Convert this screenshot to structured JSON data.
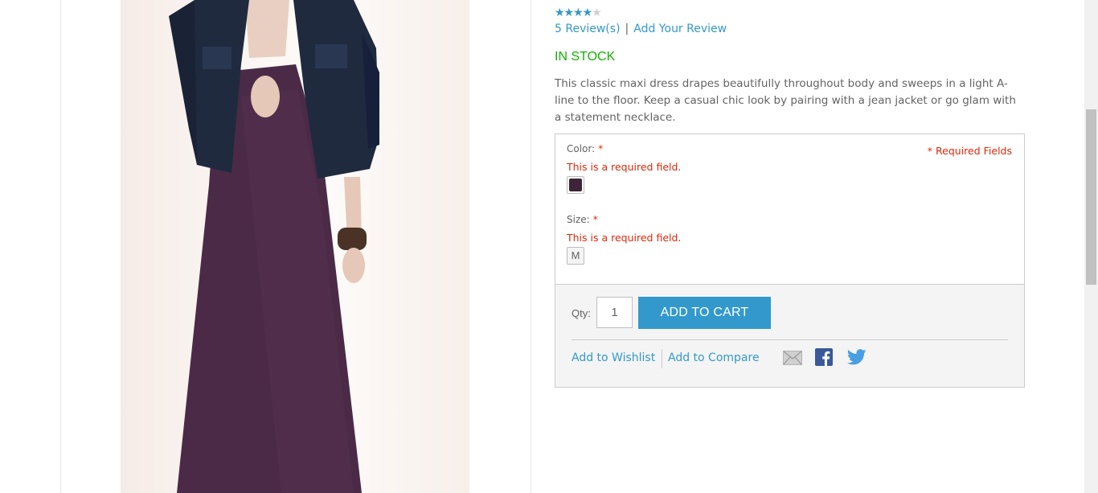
{
  "product": {
    "rating_percent": 80,
    "reviews_link": "5 Review(s)",
    "review_separator": "|",
    "add_review_link": "Add Your Review",
    "availability": "IN STOCK",
    "description": "This classic maxi dress drapes beautifully throughout body and sweeps in a light A-line to the floor. Keep a casual chic look by pairing with a jean jacket or go glam with a statement necklace."
  },
  "options": {
    "required_note": "* Required Fields",
    "color": {
      "label": "Color:",
      "required_marker": "*",
      "error": "This is a required field.",
      "swatch_color": "#3d2438"
    },
    "size": {
      "label": "Size:",
      "required_marker": "*",
      "error": "This is a required field.",
      "swatch_label": "M"
    }
  },
  "cart": {
    "qty_label": "Qty:",
    "qty_value": "1",
    "add_to_cart": "ADD TO CART",
    "wishlist_link": "Add to Wishlist",
    "compare_link": "Add to Compare",
    "share_icons": [
      "email-icon",
      "facebook-icon",
      "twitter-icon"
    ]
  },
  "colors": {
    "link": "#3399cc",
    "in_stock": "#11b400",
    "error": "#df280a",
    "button": "#3399cc",
    "dress": "#4b2a47",
    "jacket": "#1f2a3f"
  }
}
